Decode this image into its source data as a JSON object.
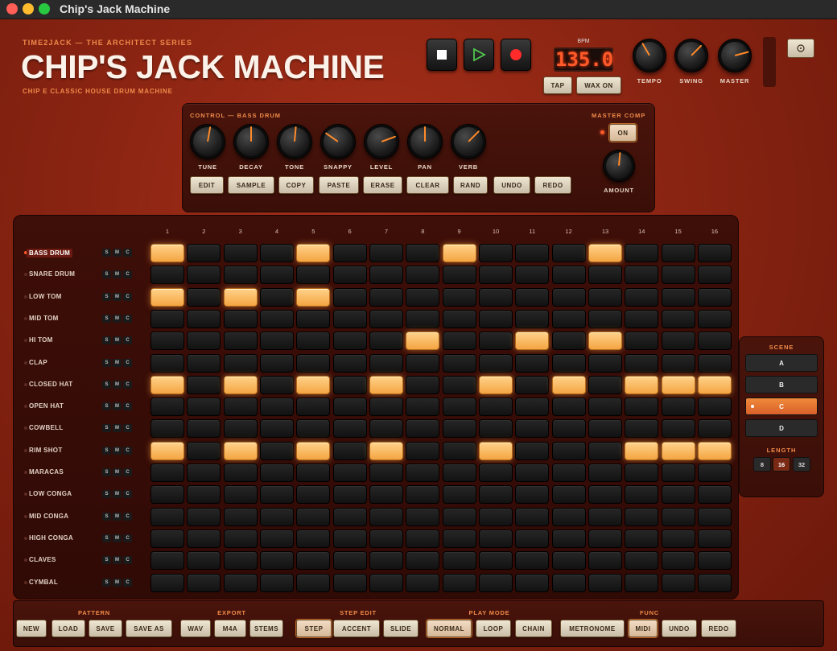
{
  "window": {
    "title": "Chip's Jack Machine"
  },
  "brand": {
    "series": "TIME2JACK — THE ARCHITECT SERIES",
    "title": "CHIP'S JACK MACHINE",
    "tagline": "CHIP E  CLASSIC HOUSE DRUM MACHINE"
  },
  "transport": {
    "stop_icon": "stop-icon",
    "play_icon": "play-icon",
    "record_icon": "record-icon",
    "colors": {
      "play": "#4ec94e",
      "record": "#ff2a2a"
    }
  },
  "bpm": {
    "label": "BPM",
    "value": "135.0"
  },
  "header_buttons": {
    "tap": "TAP",
    "wax": "WAX ON",
    "help_icon": "help-icon"
  },
  "master_knobs": [
    {
      "label": "TEMPO",
      "angle": 150
    },
    {
      "label": "SWING",
      "angle": 225
    },
    {
      "label": "MASTER",
      "angle": 255
    }
  ],
  "control": {
    "title": "CONTROL — BASS DRUM",
    "knobs": [
      {
        "label": "TUNE",
        "angle": 190
      },
      {
        "label": "DECAY",
        "angle": 180
      },
      {
        "label": "TONE",
        "angle": 185
      },
      {
        "label": "SNAPPY",
        "angle": 125
      },
      {
        "label": "LEVEL",
        "angle": 250
      },
      {
        "label": "PAN",
        "angle": 180
      },
      {
        "label": "VERB",
        "angle": 225
      }
    ],
    "buttons": [
      "EDIT",
      "SAMPLE",
      "COPY",
      "PASTE",
      "ERASE",
      "CLEAR",
      "RAND",
      "UNDO",
      "REDO"
    ]
  },
  "master_comp": {
    "title": "MASTER COMP",
    "on_label": "ON",
    "amount_label": "AMOUNT",
    "amount_angle": 185
  },
  "steps": {
    "count": 16,
    "labels": [
      "1",
      "2",
      "3",
      "4",
      "5",
      "6",
      "7",
      "8",
      "9",
      "10",
      "11",
      "12",
      "13",
      "14",
      "15",
      "16"
    ]
  },
  "track_buttons": [
    "S",
    "M",
    "C"
  ],
  "tracks": [
    {
      "name": "BASS DRUM",
      "selected": true,
      "on": [
        1,
        5,
        9,
        13
      ]
    },
    {
      "name": "SNARE DRUM",
      "selected": false,
      "on": []
    },
    {
      "name": "LOW TOM",
      "selected": false,
      "on": [
        1,
        3,
        5
      ]
    },
    {
      "name": "MID TOM",
      "selected": false,
      "on": []
    },
    {
      "name": "HI TOM",
      "selected": false,
      "on": [
        8,
        11,
        13
      ]
    },
    {
      "name": "CLAP",
      "selected": false,
      "on": []
    },
    {
      "name": "CLOSED HAT",
      "selected": false,
      "on": [
        1,
        3,
        5,
        7,
        10,
        12,
        14,
        15,
        16
      ]
    },
    {
      "name": "OPEN HAT",
      "selected": false,
      "on": []
    },
    {
      "name": "COWBELL",
      "selected": false,
      "on": []
    },
    {
      "name": "RIM SHOT",
      "selected": false,
      "on": [
        1,
        3,
        5,
        7,
        10,
        14,
        15,
        16
      ]
    },
    {
      "name": "MARACAS",
      "selected": false,
      "on": []
    },
    {
      "name": "LOW CONGA",
      "selected": false,
      "on": []
    },
    {
      "name": "MID CONGA",
      "selected": false,
      "on": []
    },
    {
      "name": "HIGH CONGA",
      "selected": false,
      "on": []
    },
    {
      "name": "CLAVES",
      "selected": false,
      "on": []
    },
    {
      "name": "CYMBAL",
      "selected": false,
      "on": []
    }
  ],
  "scene": {
    "title": "SCENE",
    "items": [
      "A",
      "B",
      "C",
      "D"
    ],
    "active": "C",
    "length_title": "LENGTH",
    "lengths": [
      "8",
      "16",
      "32"
    ],
    "active_length": "16"
  },
  "bottom": {
    "groups": [
      {
        "label": "PATTERN",
        "buttons": [
          "NEW",
          "LOAD",
          "SAVE",
          "SAVE AS"
        ],
        "active": ""
      },
      {
        "label": "EXPORT",
        "buttons": [
          "WAV",
          "M4A",
          "STEMS"
        ],
        "active": ""
      },
      {
        "label": "STEP EDIT",
        "buttons": [
          "STEP",
          "ACCENT",
          "SLIDE"
        ],
        "active": "STEP"
      },
      {
        "label": "PLAY MODE",
        "buttons": [
          "NORMAL",
          "LOOP",
          "CHAIN"
        ],
        "active": "NORMAL"
      },
      {
        "label": "FUNC",
        "buttons": [
          "METRONOME",
          "MIDI",
          "UNDO",
          "REDO"
        ],
        "active": "MIDI"
      }
    ]
  },
  "colors": {
    "accent": "#f08a4a",
    "step_on": "#f4a542",
    "indicator": "#ff5a2a"
  }
}
